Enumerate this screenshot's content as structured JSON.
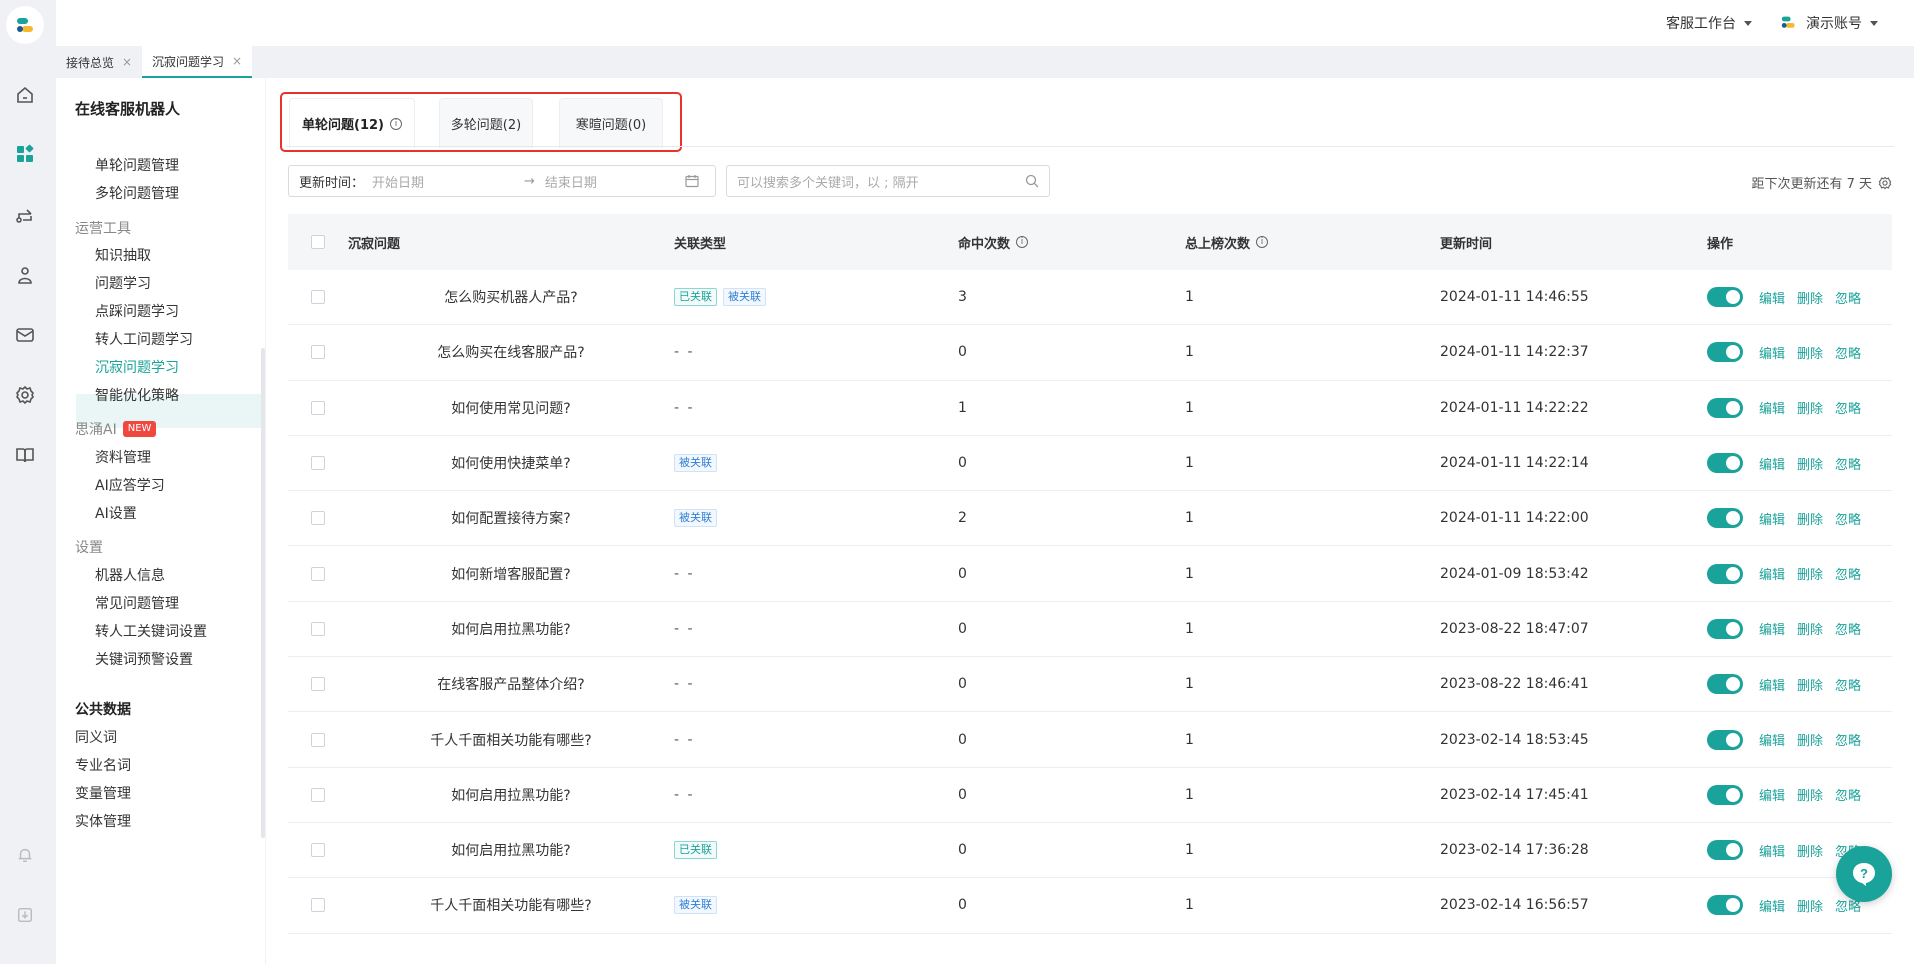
{
  "topbar": {
    "workspace": "客服工作台",
    "account": "演示账号"
  },
  "page_tabs": [
    {
      "label": "接待总览",
      "close": "×"
    },
    {
      "label": "沉寂问题学习",
      "close": "×"
    }
  ],
  "sidebar": {
    "title": "在线客服机器人",
    "items_top": [
      "单轮问题管理",
      "多轮问题管理"
    ],
    "group_ops": "运营工具",
    "items_ops": [
      "知识抽取",
      "问题学习",
      "点踩问题学习",
      "转人工问题学习",
      "沉寂问题学习",
      "智能优化策略"
    ],
    "group_ai": "思涌AI",
    "new_badge": "NEW",
    "items_ai": [
      "资料管理",
      "AI应答学习",
      "AI设置"
    ],
    "group_settings": "设置",
    "items_settings": [
      "机器人信息",
      "常见问题管理",
      "转人工关键词设置",
      "关键词预警设置"
    ],
    "group_public": "公共数据",
    "items_public": [
      "同义词",
      "专业名词",
      "变量管理",
      "实体管理"
    ]
  },
  "question_tabs": [
    {
      "label": "单轮问题(12)",
      "active": true
    },
    {
      "label": "多轮问题(2)",
      "active": false
    },
    {
      "label": "寒暄问题(0)",
      "active": false
    }
  ],
  "filters": {
    "date_label": "更新时间：",
    "start_placeholder": "开始日期",
    "arrow": "→",
    "end_placeholder": "结束日期",
    "search_placeholder": "可以搜索多个关键词，以 ; 隔开",
    "next_update": "距下次更新还有 7 天"
  },
  "table": {
    "headers": {
      "question": "沉寂问题",
      "type": "关联类型",
      "hits": "命中次数",
      "top": "总上榜次数",
      "time": "更新时间",
      "ops": "操作"
    },
    "op_labels": {
      "edit": "编辑",
      "delete": "删除",
      "ignore": "忽略"
    },
    "rows": [
      {
        "q": "怎么购买机器人产品?",
        "tags": [
          "已关联",
          "被关联"
        ],
        "hits": "3",
        "top": "1",
        "time": "2024-01-11 14:46:55"
      },
      {
        "q": "怎么购买在线客服产品?",
        "tags": [],
        "hits": "0",
        "top": "1",
        "time": "2024-01-11 14:22:37"
      },
      {
        "q": "如何使用常见问题?",
        "tags": [],
        "hits": "1",
        "top": "1",
        "time": "2024-01-11 14:22:22"
      },
      {
        "q": "如何使用快捷菜单?",
        "tags": [
          "被关联"
        ],
        "hits": "0",
        "top": "1",
        "time": "2024-01-11 14:22:14"
      },
      {
        "q": "如何配置接待方案?",
        "tags": [
          "被关联"
        ],
        "hits": "2",
        "top": "1",
        "time": "2024-01-11 14:22:00"
      },
      {
        "q": "如何新增客服配置?",
        "tags": [],
        "hits": "0",
        "top": "1",
        "time": "2024-01-09 18:53:42"
      },
      {
        "q": "如何启用拉黑功能?",
        "tags": [],
        "hits": "0",
        "top": "1",
        "time": "2023-08-22 18:47:07"
      },
      {
        "q": "在线客服产品整体介绍?",
        "tags": [],
        "hits": "0",
        "top": "1",
        "time": "2023-08-22 18:46:41"
      },
      {
        "q": "千人千面相关功能有哪些?",
        "tags": [],
        "hits": "0",
        "top": "1",
        "time": "2023-02-14 18:53:45"
      },
      {
        "q": "如何启用拉黑功能?",
        "tags": [],
        "hits": "0",
        "top": "1",
        "time": "2023-02-14 17:45:41"
      },
      {
        "q": "如何启用拉黑功能?",
        "tags": [
          "已关联"
        ],
        "hits": "0",
        "top": "1",
        "time": "2023-02-14 17:36:28"
      },
      {
        "q": "千人千面相关功能有哪些?",
        "tags": [
          "被关联"
        ],
        "hits": "0",
        "top": "1",
        "time": "2023-02-14 16:56:57"
      }
    ],
    "empty_type": "- -"
  },
  "colors": {
    "accent": "#1aa39a",
    "highlight_border": "#e8332a"
  }
}
